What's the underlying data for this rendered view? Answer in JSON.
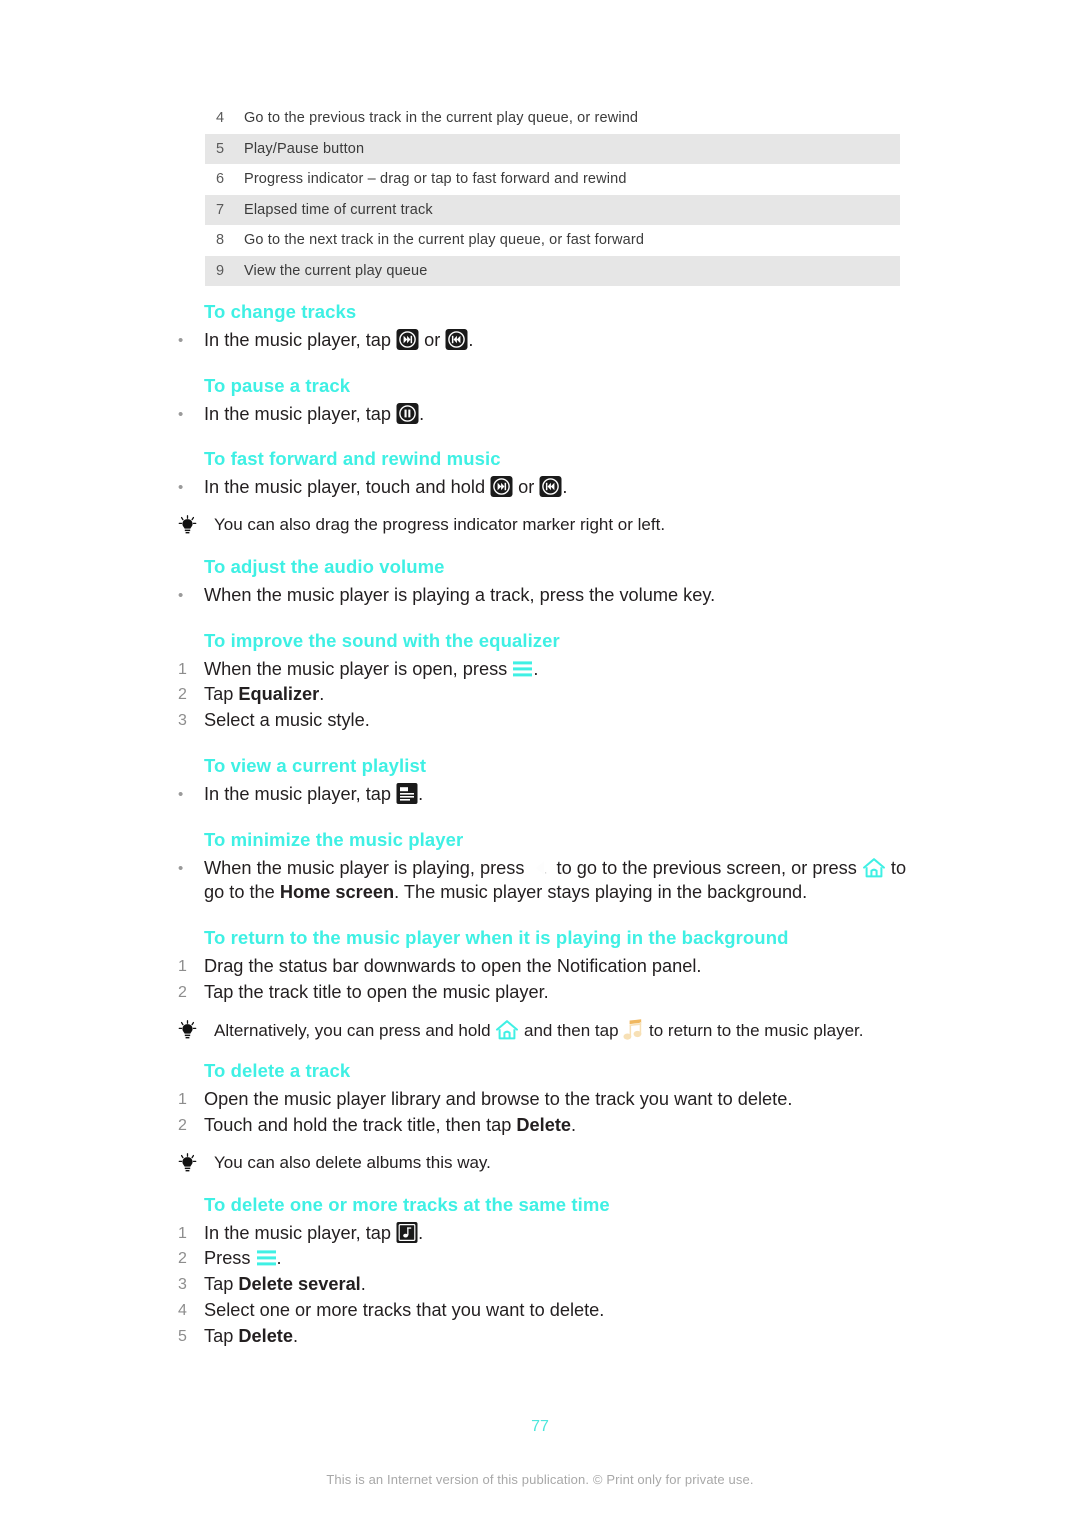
{
  "legend": {
    "rows": [
      {
        "num": "4",
        "text": "Go to the previous track in the current play queue, or rewind"
      },
      {
        "num": "5",
        "text": "Play/Pause button"
      },
      {
        "num": "6",
        "text": "Progress indicator – drag or tap to fast forward and rewind"
      },
      {
        "num": "7",
        "text": "Elapsed time of current track"
      },
      {
        "num": "8",
        "text": "Go to the next track in the current play queue, or fast forward"
      },
      {
        "num": "9",
        "text": "View the current play queue"
      }
    ]
  },
  "sections": {
    "change_tracks": {
      "title": "To change tracks",
      "step1_a": "In the music player, tap ",
      "step1_or": " or ",
      "step1_end": "."
    },
    "pause_track": {
      "title": "To pause a track",
      "step1_a": "In the music player, tap ",
      "step1_end": "."
    },
    "fast_forward": {
      "title": "To fast forward and rewind music",
      "step1_a": "In the music player, touch and hold ",
      "step1_or": " or ",
      "step1_end": ".",
      "tip": "You can also drag the progress indicator marker right or left."
    },
    "audio_volume": {
      "title": "To adjust the audio volume",
      "step1": "When the music player is playing a track, press the volume key."
    },
    "equalizer": {
      "title": "To improve the sound with the equalizer",
      "step1_a": "When the music player is open, press ",
      "step1_end": ".",
      "step2_a": "Tap ",
      "step2_bold": "Equalizer",
      "step2_end": ".",
      "step3": "Select a music style.",
      "markers": [
        "1",
        "2",
        "3"
      ]
    },
    "view_playlist": {
      "title": "To view a current playlist",
      "step1_a": "In the music player, tap ",
      "step1_end": "."
    },
    "minimize": {
      "title": "To minimize the music player",
      "step1_a": "When the music player is playing, press ",
      "step1_b": " to go to the previous screen, or press ",
      "step1_c": " to go to the ",
      "step1_bold": "Home screen",
      "step1_d": ". The music player stays playing in the background."
    },
    "return_background": {
      "title": "To return to the music player when it is playing in the background",
      "step1": "Drag the status bar downwards to open the Notification panel.",
      "step2": "Tap the track title to open the music player.",
      "markers": [
        "1",
        "2"
      ],
      "tip_a": "Alternatively, you can press and hold ",
      "tip_b": " and then tap ",
      "tip_c": " to return to the music player."
    },
    "delete_track": {
      "title": "To delete a track",
      "step1": "Open the music player library and browse to the track you want to delete.",
      "step2_a": "Touch and hold the track title, then tap ",
      "step2_bold": "Delete",
      "step2_end": ".",
      "markers": [
        "1",
        "2"
      ],
      "tip": "You can also delete albums this way."
    },
    "delete_several": {
      "title": "To delete one or more tracks at the same time",
      "step1_a": "In the music player, tap ",
      "step1_end": ".",
      "step2_a": "Press ",
      "step2_end": ".",
      "step3_a": "Tap ",
      "step3_bold": "Delete several",
      "step3_end": ".",
      "step4": "Select one or more tracks that you want to delete.",
      "step5_a": "Tap ",
      "step5_bold": "Delete",
      "step5_end": ".",
      "markers": [
        "1",
        "2",
        "3",
        "4",
        "5"
      ]
    }
  },
  "footer": {
    "page_number": "77",
    "note": "This is an Internet version of this publication. © Print only for private use."
  },
  "colors": {
    "heading": "#3ff0e4",
    "row_shade": "#e6e6e6",
    "text": "#231f20",
    "marker": "#8d8d8d",
    "footer": "#a8a8a8"
  }
}
